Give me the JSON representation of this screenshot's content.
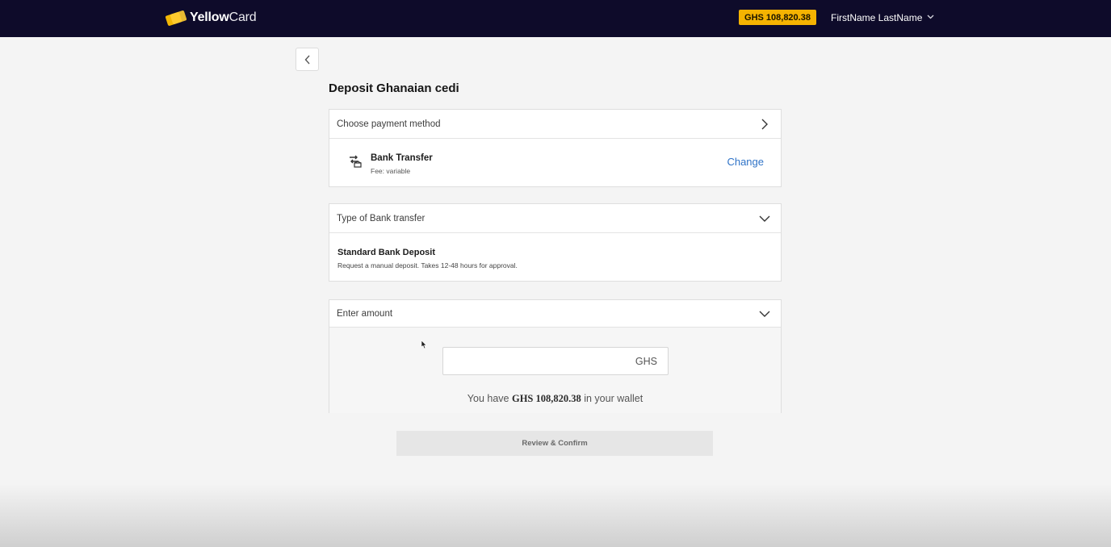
{
  "header": {
    "logo_bold": "Yellow",
    "logo_light": "Card",
    "balance": "GHS 108,820.38",
    "user_name": "FirstName LastName"
  },
  "page": {
    "title": "Deposit Ghanaian cedi"
  },
  "payment_method": {
    "heading": "Choose payment method",
    "name": "Bank Transfer",
    "fee": "Fee: variable",
    "change_label": "Change"
  },
  "bank_transfer_type": {
    "heading": "Type of Bank transfer",
    "name": "Standard Bank Deposit",
    "description": "Request a manual deposit. Takes 12-48 hours for approval."
  },
  "amount": {
    "heading": "Enter amount",
    "value": "",
    "currency": "GHS",
    "wallet_prefix": "You have",
    "wallet_amount": "GHS 108,820.38",
    "wallet_suffix": "in your wallet"
  },
  "actions": {
    "confirm_label": "Review & Confirm"
  },
  "colors": {
    "nav_bg": "#0e0b2a",
    "brand_yellow": "#f5b301",
    "link_blue": "#2f73c7",
    "disabled_button": "#e6e6e6"
  },
  "icons": {
    "back": "chevron-left-icon",
    "expand_payment": "chevron-right-icon",
    "collapse": "chevron-down-icon",
    "bank": "bank-transfer-icon"
  }
}
